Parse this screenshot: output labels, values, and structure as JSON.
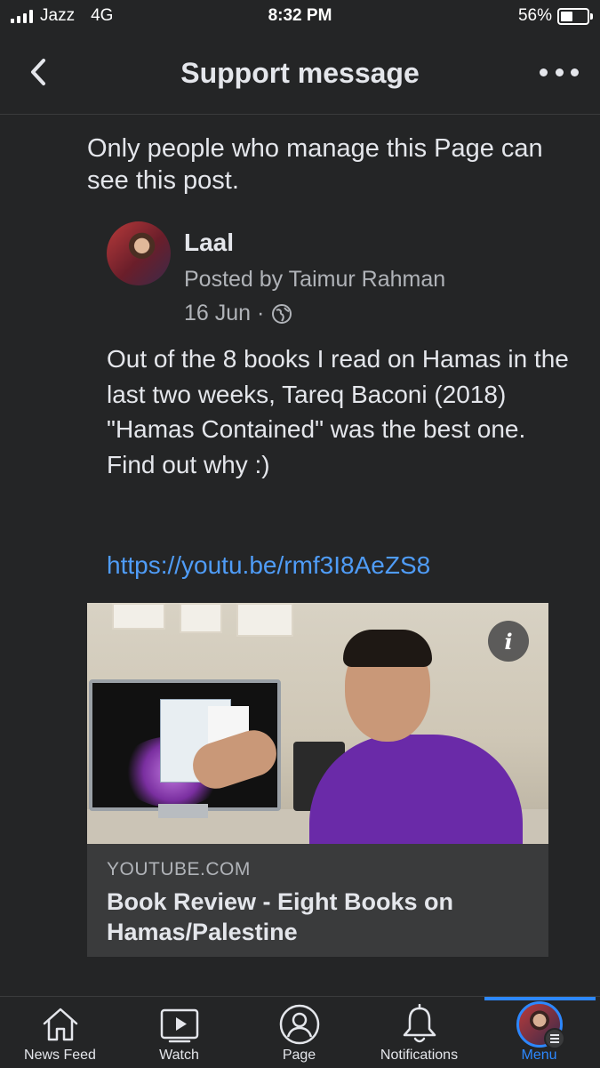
{
  "status_bar": {
    "carrier": "Jazz",
    "network": "4G",
    "time": "8:32 PM",
    "battery": "56%",
    "battery_level": 0.56
  },
  "header": {
    "title": "Support message",
    "back_icon": "chevron-left-icon",
    "more_icon": "more-dots-icon"
  },
  "notice": "Only people who manage this Page can see this post.",
  "post": {
    "page_name": "Laal",
    "posted_by": "Posted by Taimur Rahman",
    "date": "16 Jun ·",
    "privacy_icon": "globe-icon",
    "text": "Out of the 8 books I read on Hamas in the last two weeks, Tareq Baconi (2018) \"Hamas Contained\" was the best one. Find out why :)",
    "link": "https://youtu.be/rmf3I8AeZS8"
  },
  "link_card": {
    "domain": "YOUTUBE.COM",
    "title": "Book Review - Eight Books on Hamas/Palestine",
    "info_label": "i"
  },
  "tabbar": {
    "tabs": [
      {
        "label": "News Feed",
        "icon": "home-icon"
      },
      {
        "label": "Watch",
        "icon": "play-video-icon"
      },
      {
        "label": "Page",
        "icon": "profile-icon"
      },
      {
        "label": "Notifications",
        "icon": "bell-icon"
      },
      {
        "label": "Menu",
        "icon": "avatar-menu-icon"
      }
    ],
    "active": "Menu",
    "accent": "#2d88ff"
  },
  "colors": {
    "background": "#242526",
    "text": "#e4e6eb",
    "secondary_text": "#b0b3b8",
    "link": "#4f9cf7"
  }
}
